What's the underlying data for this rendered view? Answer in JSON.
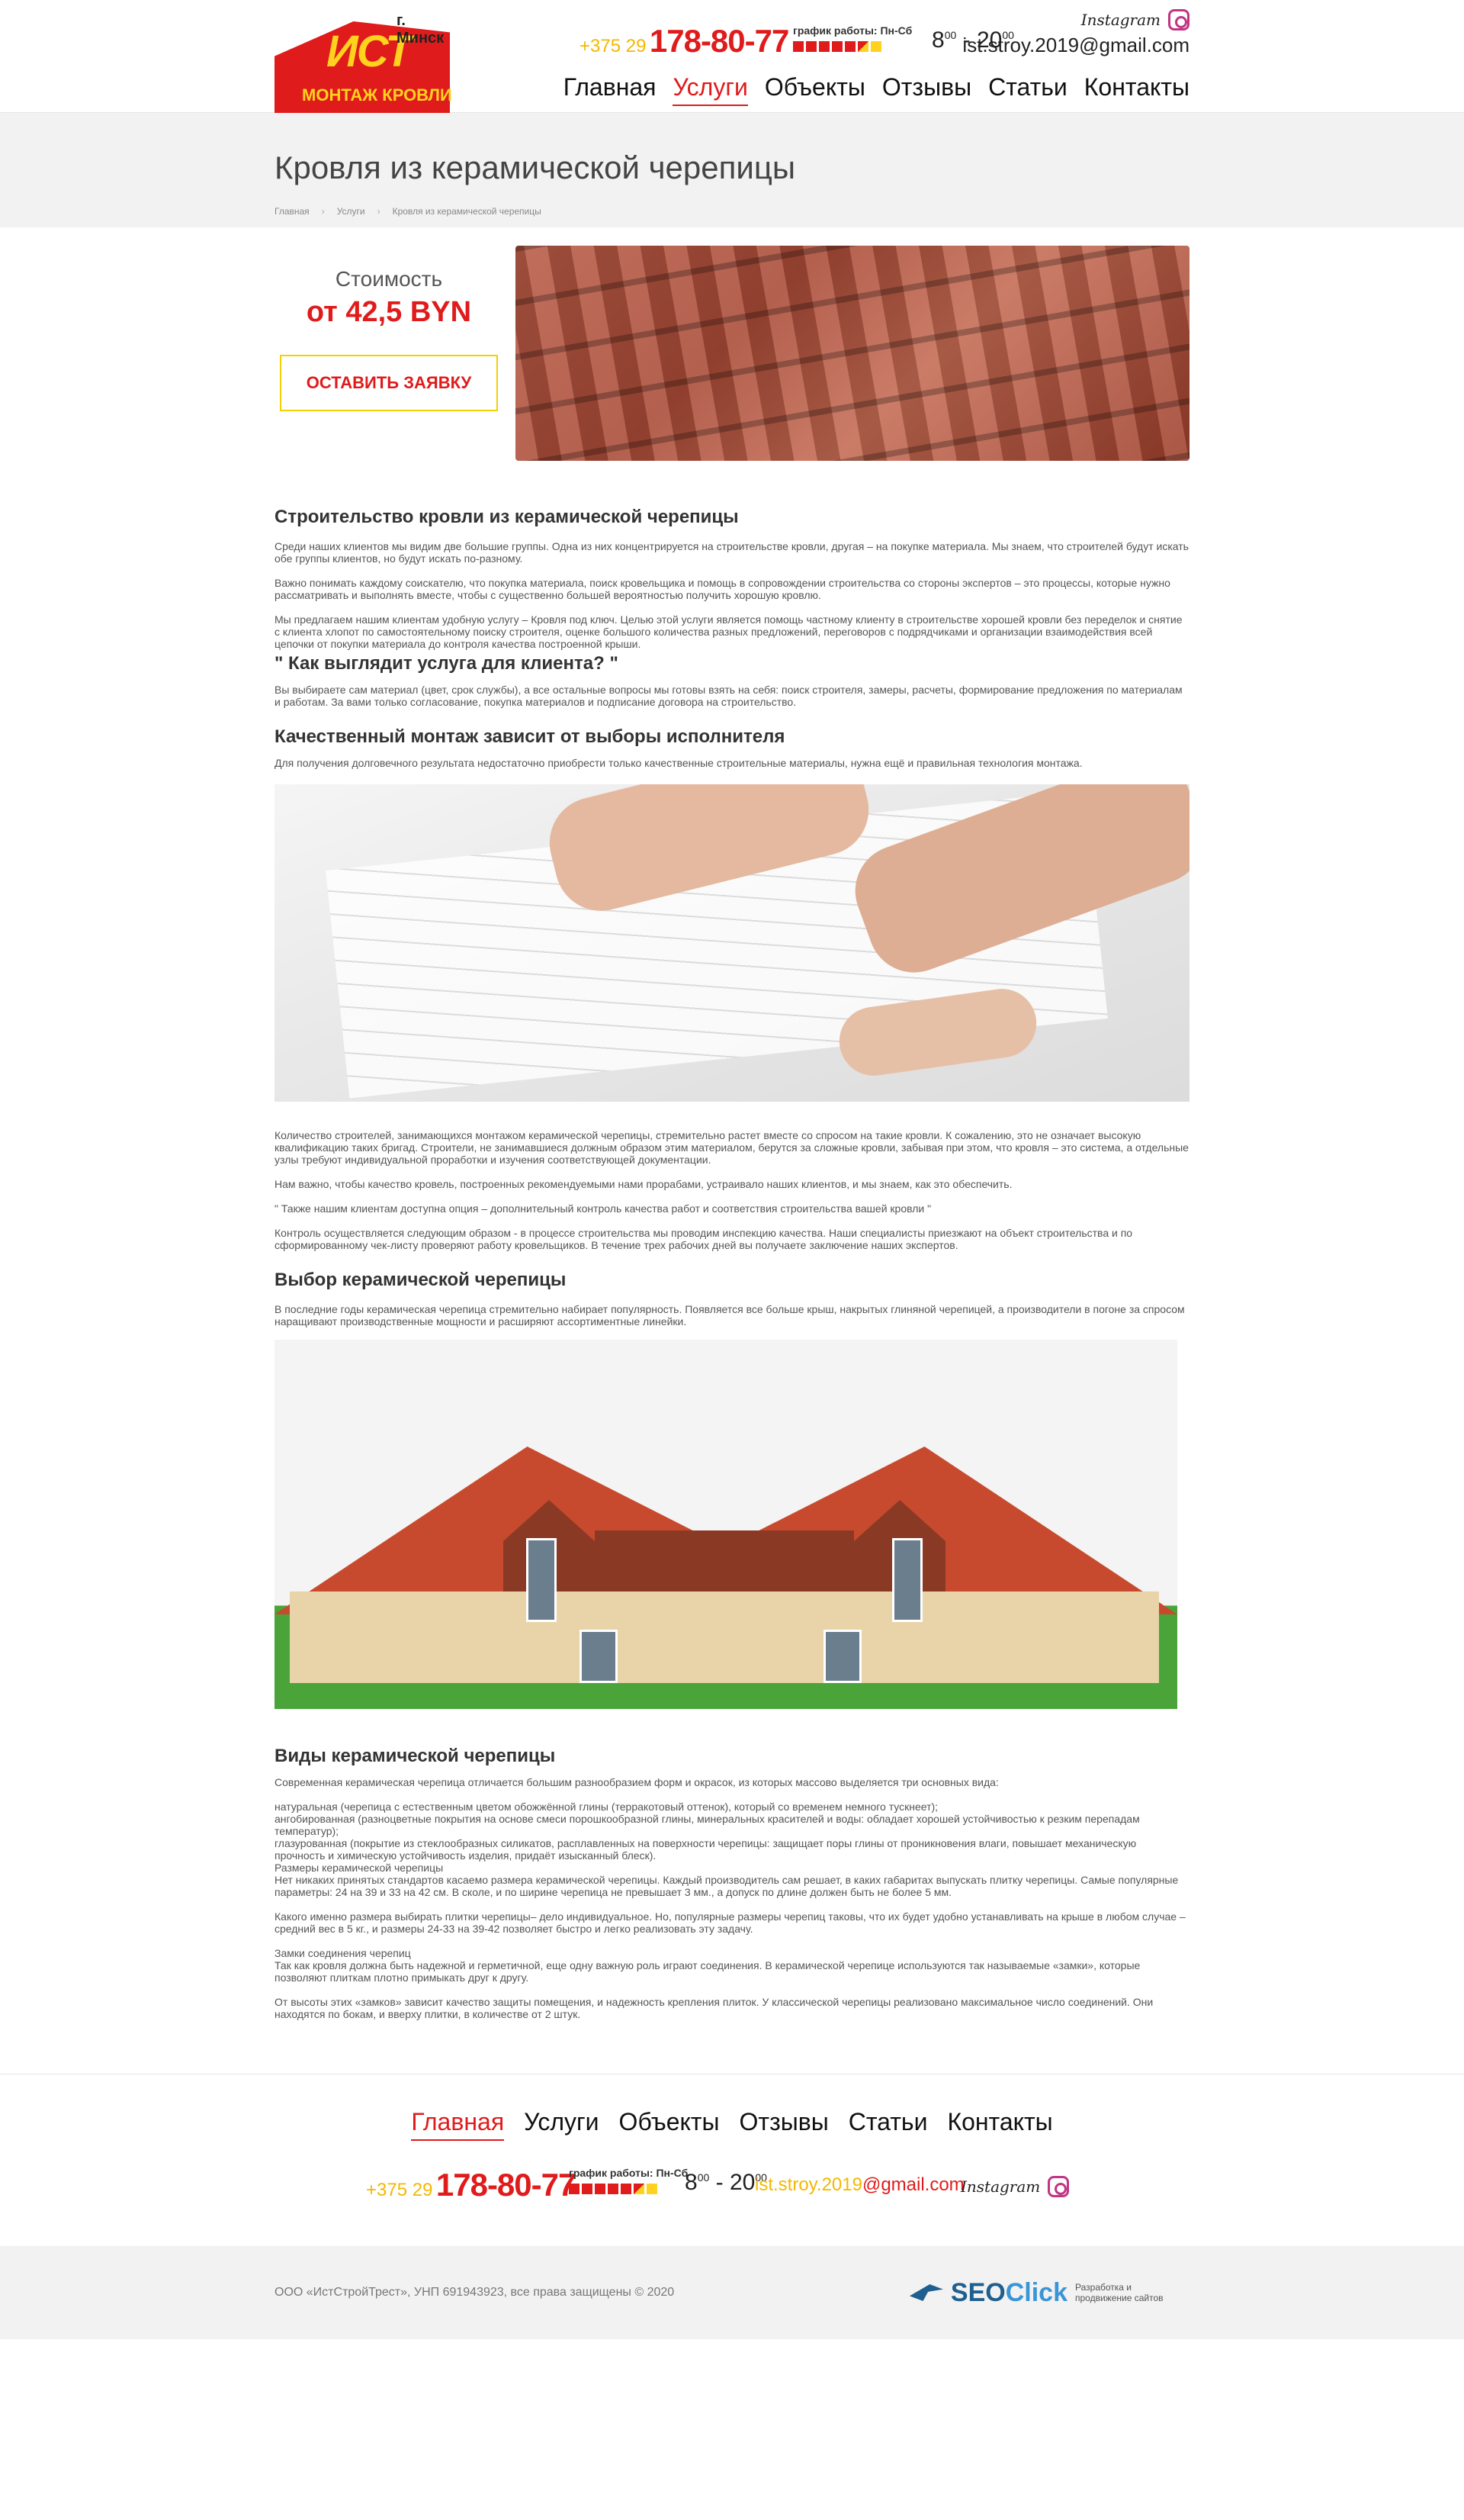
{
  "header": {
    "logo": {
      "city": "г. Минск",
      "brand": "ИСТ",
      "subtitle": "МОНТАЖ КРОВЛИ"
    },
    "phone_code": "+375 29",
    "phone_number": "178-80-77",
    "schedule_label": "график работы: Пн-Сб",
    "hours_from": "8",
    "hours_from_sup": "00",
    "hours_dash": " - ",
    "hours_to": "20",
    "hours_to_sup": "00",
    "email": "ist.stroy.2019@gmail.com",
    "instagram_label": "Instagram",
    "nav": [
      {
        "label": "Главная"
      },
      {
        "label": "Услуги"
      },
      {
        "label": "Объекты"
      },
      {
        "label": "Отзывы"
      },
      {
        "label": "Статьи"
      },
      {
        "label": "Контакты"
      }
    ]
  },
  "title_band": {
    "title": "Кровля из керамической черепицы",
    "breadcrumb": [
      "Главная",
      "Услуги",
      "Кровля из керамической черепицы"
    ],
    "separator": "›"
  },
  "hero": {
    "price_label": "Стоимость",
    "price_value": "от 42,5 BYN",
    "order_button": "ОСТАВИТЬ ЗАЯВКУ"
  },
  "content": {
    "h_building": "Строительство кровли из керамической черепицы",
    "p1": "Среди наших клиентов мы видим две большие группы. Одна из них концентрируется на строительстве кровли, другая – на покупке материала. Мы знаем, что строителей будут искать обе группы клиентов, но будут искать по-разному.",
    "p2": "Важно понимать каждому соискателю, что покупка материала, поиск кровельщика и помощь в сопровождении строительства со стороны экспертов – это процессы, которые нужно рассматривать и выполнять вместе, чтобы с существенно большей вероятностью получить хорошую кровлю.",
    "p3": "Мы предлагаем нашим клиентам удобную услугу – Кровля под ключ. Целью этой услуги является помощь частному клиенту в строительстве хорошей кровли без переделок и снятие с клиента хлопот по самостоятельному поиску строителя, оценке большого количества разных предложений, переговоров с подрядчиками и организации взаимодействия всей цепочки от покупки материала до контроля качества построенной крыши.",
    "h_service": "\" Как выглядит услуга для клиента? \"",
    "p4": "Вы выбираете сам материал (цвет, срок службы), а все остальные вопросы мы готовы взять на себя: поиск строителя, замеры, расчеты, формирование предложения по материалам и работам. За вами только согласование, покупка материалов и подписание договора на строительство.",
    "h_quality": "Качественный монтаж зависит от выборы исполнителя",
    "p5": "Для получения долговечного результата недостаточно приобрести только качественные строительные материалы, нужна ещё и правильная технология монтажа.",
    "p6": "Количество строителей, занимающихся монтажом керамической черепицы, стремительно растет вместе со спросом на такие кровли. К сожалению, это не означает высокую квалификацию таких бригад. Строители, не занимавшиеся должным образом этим материалом, берутся за сложные кровли, забывая при этом, что кровля – это система, а отдельные узлы требуют индивидуальной проработки и изучения соответствующей документации.",
    "p7": "Нам важно, чтобы качество кровель, построенных рекомендуемыми нами прорабами, устраивало наших клиентов, и мы знаем, как это обеспечить.",
    "p8": "\" Также нашим клиентам доступна опция – дополнительный контроль качества работ и соответствия строительства вашей кровли \"",
    "p9": "Контроль осуществляется следующим образом - в процессе строительства мы проводим инспекцию качества. Наши специалисты приезжают на объект строительства и по сформированному чек-листу проверяют работу кровельщиков. В течение трех рабочих дней вы получаете заключение наших экспертов.",
    "h_choice": "Выбор керамической черепицы",
    "p10": "В последние годы керамическая черепица стремительно набирает популярность. Появляется все больше крыш, накрытых глиняной черепицей, а производители в погоне за спросом наращивают производственные мощности и расширяют ассортиментные линейки.",
    "h_types": "Виды керамической черепицы",
    "p11": "Современная керамическая черепица отличается большим разнообразием форм и окрасок, из которых массово выделяется три основных вида:",
    "l1": "натуральная (черепица с естественным цветом обожжённой глины (терракотовый оттенок), который со временем немного тускнеет);",
    "l2": "ангобированная (разноцветные покрытия на основе смеси порошкообразной глины, минеральных красителей и воды: обладает хорошей устойчивостью к резким перепадам температур);",
    "l3": "глазурованная (покрытие из стеклообразных силикатов, расплавленных на поверхности черепицы: защищает поры глины от проникновения влаги, повышает механическую прочность и химическую устойчивость изделия, придаёт изысканный блеск).",
    "l4": "Размеры керамической черепицы",
    "l5": "Нет никаких принятых стандартов касаемо размера керамической черепицы. Каждый производитель сам решает, в каких габаритах выпускать плитку черепицы. Самые популярные параметры: 24 на 39 и 33 на 42 см. В сколе, и по ширине черепица не превышает 3 мм., а допуск по длине должен быть не более 5 мм.",
    "p12": "Какого именно размера выбирать плитки черепицы– дело индивидуальное. Но, популярные размеры черепиц таковы, что их будет удобно устанавливать на крыше в любом случае – средний вес в 5 кг., и размеры 24-33 на 39-42 позволяет быстро и легко реализовать эту задачу.",
    "l6": "Замки соединения черепиц",
    "l7": "Так как кровля должна быть надежной и герметичной, еще одну важную роль играют соединения. В керамической черепице используются так называемые «замки», которые позволяют плиткам плотно примыкать друг к другу.",
    "p13": "От высоты этих «замков» зависит качество защиты помещения, и надежность крепления плиток. У классической черепицы реализовано максимальное число соединений. Они находятся по бокам, и вверху плитки, в количестве от 2 штук."
  },
  "footer": {
    "email_user": "ist.stroy.2019",
    "email_domain": "@gmail.com",
    "copyright": "ООО «ИстСтройТрест», УНП 691943923, все права защищены © 2020",
    "dev_logo_seo": "SEO",
    "dev_logo_click": "Click",
    "dev_text": "Разработка и продвижение сайтов"
  },
  "colors": {
    "accent": "#e01b1b",
    "yellow": "#ffd21f",
    "band": "#f2f2f2"
  }
}
